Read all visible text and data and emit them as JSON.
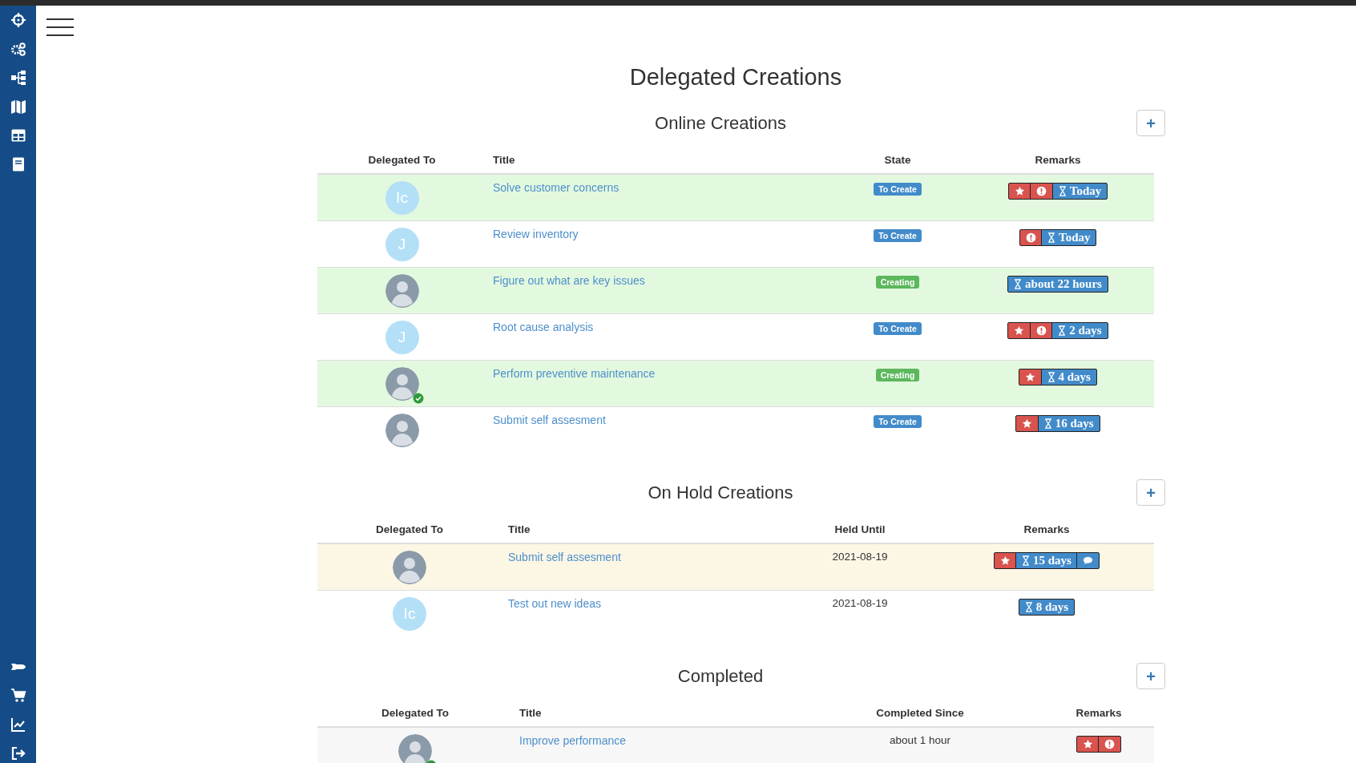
{
  "page_title": "Delegated Creations",
  "sections": [
    {
      "title": "Online Creations",
      "add_button": "+",
      "columns": [
        "Delegated To",
        "Title",
        "State",
        "Remarks"
      ],
      "rows": [
        {
          "color": "#e3f9df",
          "avatar": {
            "kind": "initials",
            "text": "Ic",
            "online": false
          },
          "title": "Solve customer concerns",
          "state": {
            "kind": "to_create",
            "label": "To Create"
          },
          "remarks": [
            {
              "kind": "star"
            },
            {
              "kind": "alert"
            },
            {
              "kind": "due",
              "text": "Today"
            }
          ]
        },
        {
          "color": "#ffffff",
          "avatar": {
            "kind": "initials",
            "text": "J",
            "online": false
          },
          "title": "Review inventory",
          "state": {
            "kind": "to_create",
            "label": "To Create"
          },
          "remarks": [
            {
              "kind": "alert"
            },
            {
              "kind": "due",
              "text": "Today"
            }
          ]
        },
        {
          "color": "#e3f9df",
          "avatar": {
            "kind": "photo",
            "online": false
          },
          "title": "Figure out what are key issues",
          "state": {
            "kind": "creating",
            "label": "Creating"
          },
          "remarks": [
            {
              "kind": "due",
              "text": "about 22 hours"
            }
          ]
        },
        {
          "color": "#ffffff",
          "avatar": {
            "kind": "initials",
            "text": "J",
            "online": false
          },
          "title": "Root cause analysis",
          "state": {
            "kind": "to_create",
            "label": "To Create"
          },
          "remarks": [
            {
              "kind": "star"
            },
            {
              "kind": "alert"
            },
            {
              "kind": "due",
              "text": "2 days"
            }
          ]
        },
        {
          "color": "#e3f9df",
          "avatar": {
            "kind": "photo",
            "online": true
          },
          "title": "Perform preventive maintenance",
          "state": {
            "kind": "creating",
            "label": "Creating"
          },
          "remarks": [
            {
              "kind": "star"
            },
            {
              "kind": "due",
              "text": "4 days"
            }
          ]
        },
        {
          "color": "#ffffff",
          "avatar": {
            "kind": "photo",
            "online": false
          },
          "title": "Submit self assesment",
          "state": {
            "kind": "to_create",
            "label": "To Create"
          },
          "remarks": [
            {
              "kind": "star"
            },
            {
              "kind": "due",
              "text": "16 days"
            }
          ]
        }
      ]
    },
    {
      "title": "On Hold Creations",
      "add_button": "+",
      "columns": [
        "Delegated To",
        "Title",
        "Held Until",
        "Remarks"
      ],
      "rows": [
        {
          "color": "#fcf6e5",
          "avatar": {
            "kind": "photo",
            "online": false
          },
          "title": "Submit self assesment",
          "held_until": "2021-08-19",
          "remarks": [
            {
              "kind": "star"
            },
            {
              "kind": "due",
              "text": "15 days"
            },
            {
              "kind": "comment"
            }
          ]
        },
        {
          "color": "#ffffff",
          "avatar": {
            "kind": "initials",
            "text": "Ic",
            "online": false
          },
          "title": "Test out new ideas",
          "held_until": "2021-08-19",
          "remarks": [
            {
              "kind": "due",
              "text": "8 days"
            }
          ]
        }
      ]
    },
    {
      "title": "Completed",
      "add_button": "+",
      "columns": [
        "Delegated To",
        "Title",
        "Completed Since",
        "Remarks"
      ],
      "rows": [
        {
          "color": "#f7f7f7",
          "avatar": {
            "kind": "photo",
            "online": true
          },
          "title": "Improve performance",
          "completed_since": "about 1 hour",
          "remarks": [
            {
              "kind": "star"
            },
            {
              "kind": "alert"
            }
          ]
        }
      ]
    }
  ]
}
